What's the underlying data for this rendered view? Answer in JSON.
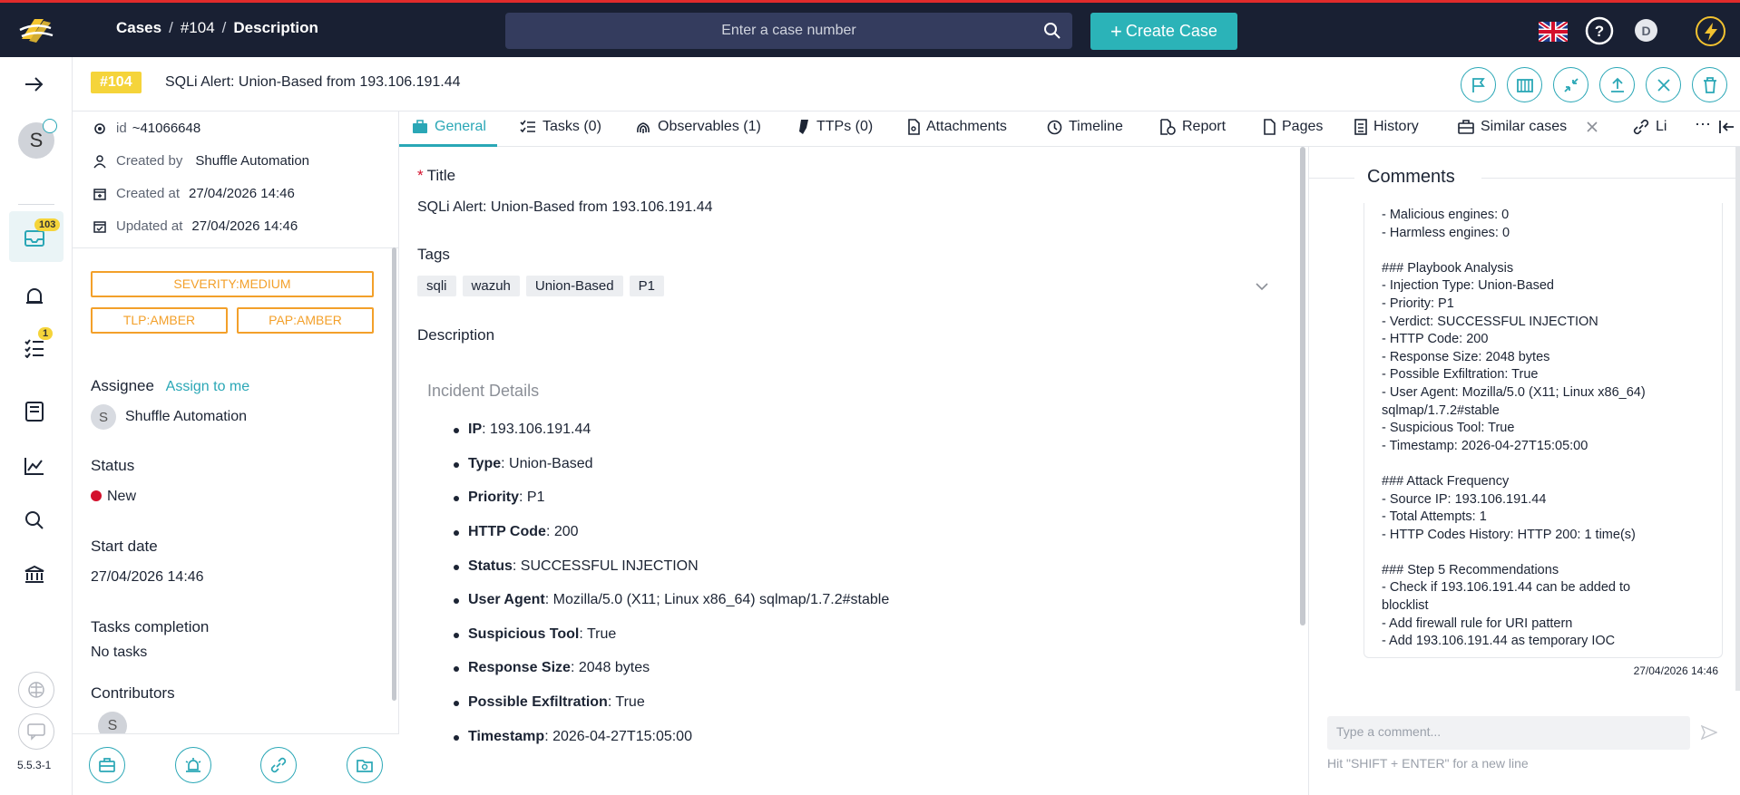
{
  "topbar": {
    "breadcrumb": {
      "cases": "Cases",
      "sep1": "/",
      "case": "#104",
      "sep2": "/",
      "current": "Description"
    },
    "search_placeholder": "Enter a case number",
    "create_label": "Create Case",
    "avatar_initial": "D",
    "colors": {
      "bg": "#192033",
      "accent": "#2bb3b8",
      "top_border": "#e02b2b"
    }
  },
  "rail": {
    "user_initial": "S",
    "cases_badge": "103",
    "tasks_badge": "1",
    "version": "5.5.3-1"
  },
  "casebar": {
    "number": "#104",
    "title": "SQLi Alert: Union-Based from 193.106.191.44"
  },
  "details": {
    "id": "~41066648",
    "id_label": "id",
    "created_by_label": "Created by",
    "created_by": "Shuffle Automation",
    "created_at_label": "Created at",
    "created_at": "27/04/2026 14:46",
    "updated_at_label": "Updated at",
    "updated_at": "27/04/2026 14:46",
    "severity": "SEVERITY:MEDIUM",
    "tlp": "TLP:AMBER",
    "pap": "PAP:AMBER",
    "assignee_label": "Assignee",
    "assign_to_me": "Assign to me",
    "assignee_initial": "S",
    "assignee": "Shuffle Automation",
    "status_label": "Status",
    "status": "New",
    "start_date_label": "Start date",
    "start_date": "27/04/2026 14:46",
    "tasks_label": "Tasks completion",
    "tasks_value": "No tasks",
    "contributors_label": "Contributors",
    "contributor_initial": "S"
  },
  "tabs": [
    {
      "label": "General",
      "icon": "briefcase-icon"
    },
    {
      "label": "Tasks (0)",
      "icon": "tasks-icon"
    },
    {
      "label": "Observables (1)",
      "icon": "fingerprint-icon"
    },
    {
      "label": "TTPs (0)",
      "icon": "mask-icon"
    },
    {
      "label": "Attachments",
      "icon": "file-icon"
    },
    {
      "label": "Timeline",
      "icon": "clock-icon"
    },
    {
      "label": "Report",
      "icon": "report-icon"
    },
    {
      "label": "Pages",
      "icon": "page-icon"
    },
    {
      "label": "History",
      "icon": "history-icon"
    },
    {
      "label": "Similar cases",
      "icon": "similar-icon"
    },
    {
      "label": "Li",
      "icon": "link-icon"
    }
  ],
  "general": {
    "title_label": "Title",
    "title_value": "SQLi Alert: Union-Based from 193.106.191.44",
    "tags_label": "Tags",
    "tags": [
      "sqli",
      "wazuh",
      "Union-Based",
      "P1"
    ],
    "description_label": "Description",
    "incident_heading": "Incident Details",
    "bullets": [
      {
        "key": "IP",
        "value": ": 193.106.191.44"
      },
      {
        "key": "Type",
        "value": ": Union-Based"
      },
      {
        "key": "Priority",
        "value": ": P1"
      },
      {
        "key": "HTTP Code",
        "value": ": 200"
      },
      {
        "key": "Status",
        "value": ": SUCCESSFUL INJECTION"
      },
      {
        "key": "User Agent",
        "value": ": Mozilla/5.0 (X11; Linux x86_64) sqlmap/1.7.2#stable"
      },
      {
        "key": "Suspicious Tool",
        "value": ": True"
      },
      {
        "key": "Response Size",
        "value": ": 2048 bytes"
      },
      {
        "key": "Possible Exfiltration",
        "value": ": True"
      },
      {
        "key": "Timestamp",
        "value": ": 2026-04-27T15:05:00"
      }
    ]
  },
  "comments": {
    "title": "Comments",
    "body": "- Malicious engines: 0\n- Harmless engines: 0\n\n### Playbook Analysis\n- Injection Type: Union-Based\n- Priority: P1\n- Verdict: SUCCESSFUL INJECTION\n- HTTP Code: 200\n- Response Size: 2048 bytes\n- Possible Exfiltration: True\n- User Agent: Mozilla/5.0 (X11; Linux x86_64)\nsqlmap/1.7.2#stable\n- Suspicious Tool: True\n- Timestamp: 2026-04-27T15:05:00\n\n### Attack Frequency\n- Source IP: 193.106.191.44\n- Total Attempts: 1\n- HTTP Codes History: HTTP 200: 1 time(s)\n\n### Step 5 Recommendations\n- Check if 193.106.191.44 can be added to\nblocklist\n- Add firewall rule for URI pattern\n- Add 193.106.191.44 as temporary IOC",
    "date": "27/04/2026 14:46",
    "placeholder": "Type a comment...",
    "hint": "Hit \"SHIFT + ENTER\" for a new line"
  }
}
